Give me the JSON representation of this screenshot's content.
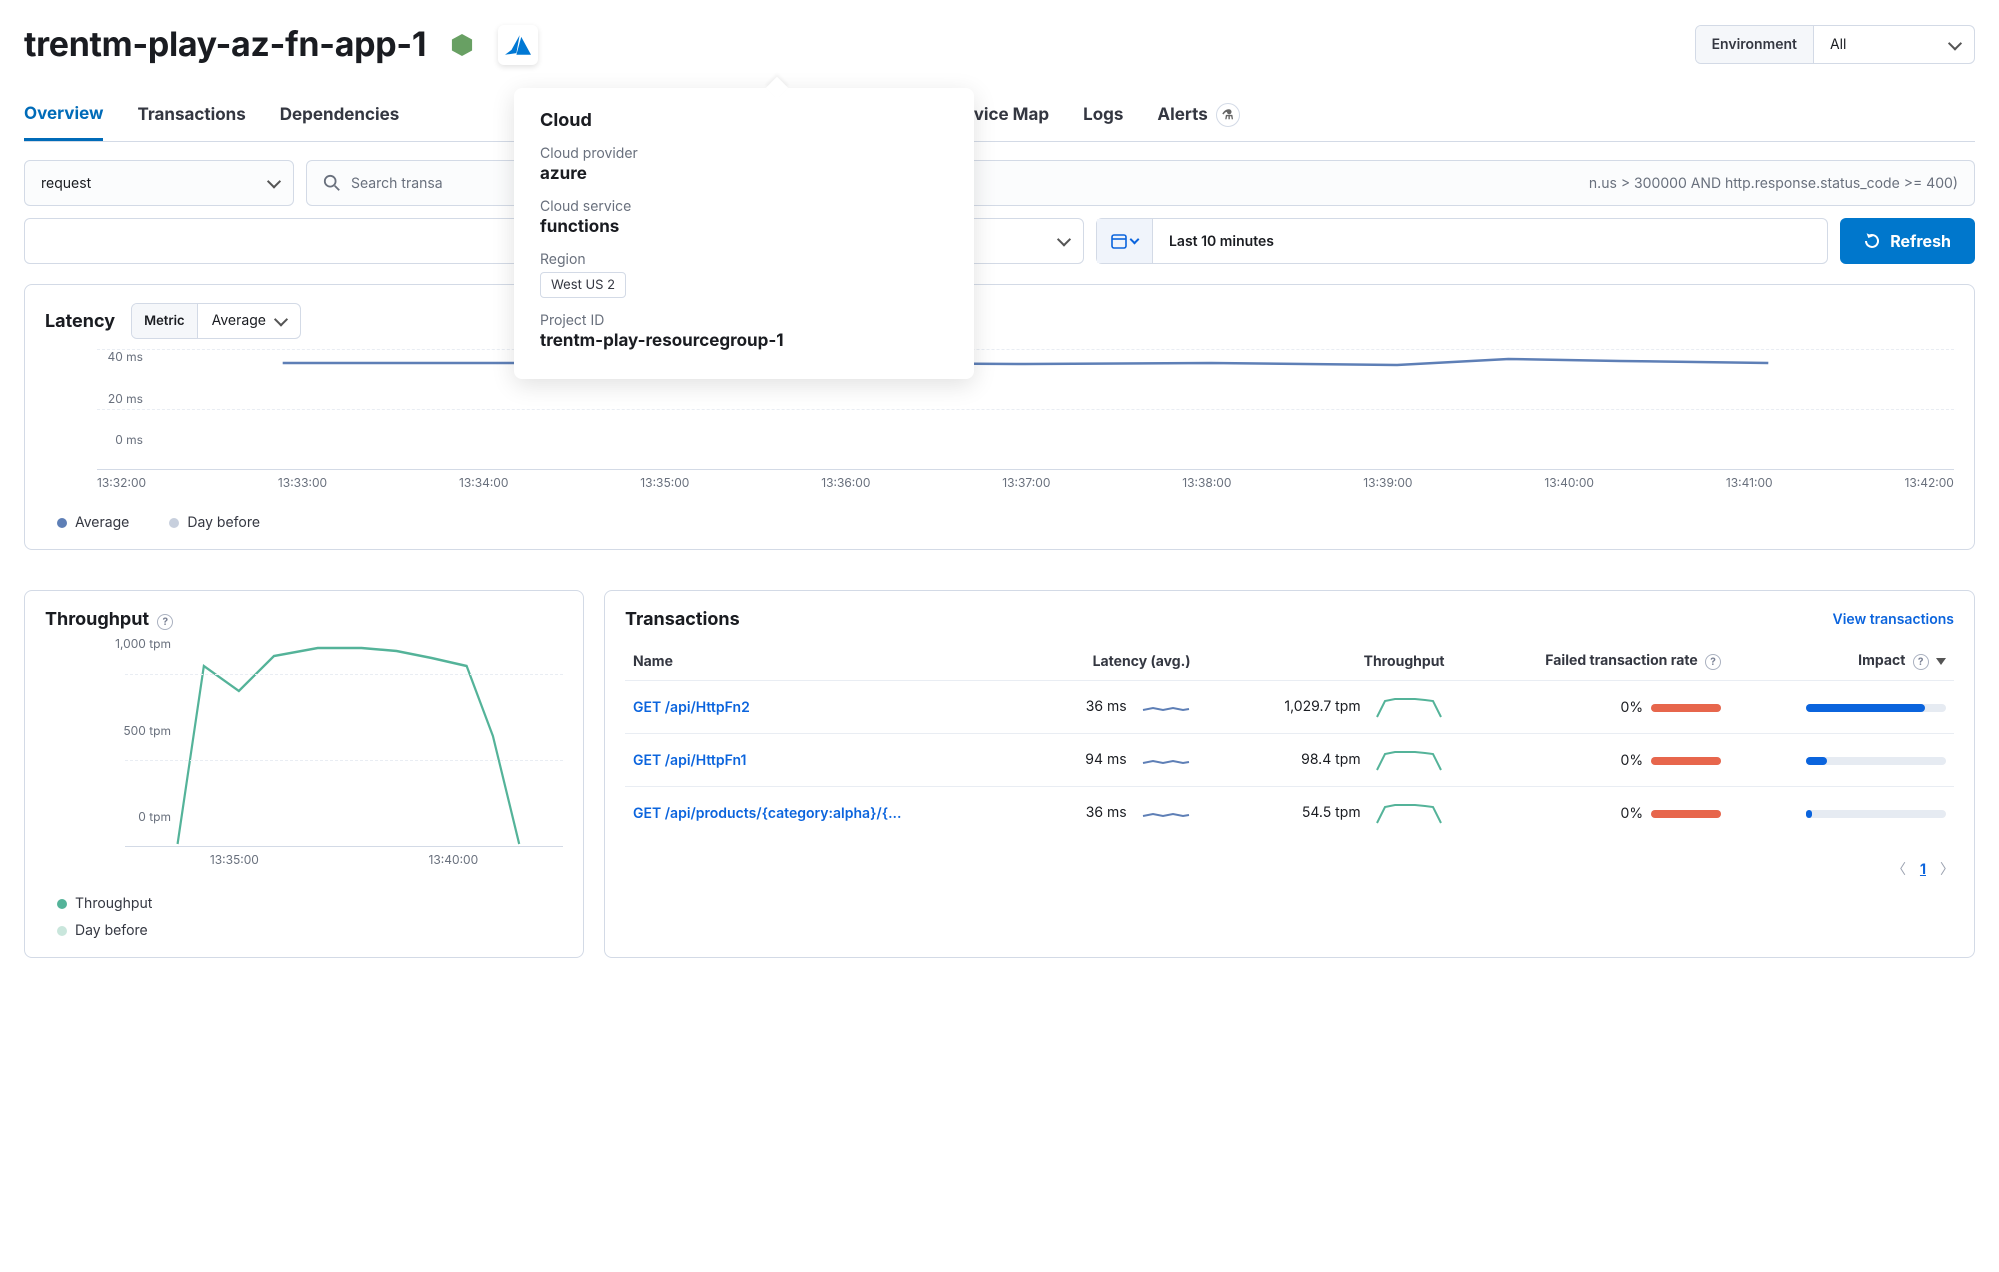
{
  "header": {
    "title": "trentm-play-az-fn-app-1",
    "icons": [
      "nodejs",
      "azure"
    ],
    "env_label": "Environment",
    "env_value": "All"
  },
  "popover": {
    "title": "Cloud",
    "provider_label": "Cloud provider",
    "provider_value": "azure",
    "service_label": "Cloud service",
    "service_value": "functions",
    "region_label": "Region",
    "region_value": "West US 2",
    "project_label": "Project ID",
    "project_value": "trentm-play-resourcegroup-1"
  },
  "tabs": [
    "Overview",
    "Transactions",
    "Dependencies",
    "",
    "",
    "Service Map",
    "Logs",
    "Alerts"
  ],
  "filters": {
    "type_filter": "request",
    "search_placeholder": "Search transa",
    "search_tail": "n.us > 300000 AND http.response.status_code >= 400)",
    "comparison": "",
    "date_range": "Last 10 minutes",
    "refresh": "Refresh"
  },
  "latency": {
    "title": "Latency",
    "metric_label": "Metric",
    "metric_value": "Average",
    "legend_primary": "Average",
    "legend_secondary": "Day before"
  },
  "throughput": {
    "title": "Throughput",
    "legend_primary": "Throughput",
    "legend_secondary": "Day before"
  },
  "transactions_panel": {
    "title": "Transactions",
    "view_link": "View transactions",
    "cols": {
      "name": "Name",
      "latency": "Latency (avg.)",
      "throughput": "Throughput",
      "failed": "Failed transaction rate",
      "impact": "Impact"
    },
    "rows": [
      {
        "name": "GET /api/HttpFn2",
        "latency": "36 ms",
        "throughput": "1,029.7 tpm",
        "failed": "0%",
        "impact": 0.85
      },
      {
        "name": "GET /api/HttpFn1",
        "latency": "94 ms",
        "throughput": "98.4 tpm",
        "failed": "0%",
        "impact": 0.15
      },
      {
        "name": "GET /api/products/{category:alpha}/{...",
        "latency": "36 ms",
        "throughput": "54.5 tpm",
        "failed": "0%",
        "impact": 0.04
      }
    ],
    "page": "1"
  },
  "chart_data": [
    {
      "type": "line",
      "title": "Latency",
      "ylabel": "ms",
      "ylim": [
        0,
        45
      ],
      "yticks": [
        "40 ms",
        "20 ms",
        "0 ms"
      ],
      "x": [
        "13:32:00",
        "13:33:00",
        "13:34:00",
        "13:35:00",
        "13:36:00",
        "13:37:00",
        "13:38:00",
        "13:39:00",
        "13:40:00",
        "13:41:00",
        "13:42:00"
      ],
      "series": [
        {
          "name": "Average",
          "color": "#5e7fb6",
          "values": [
            null,
            40,
            40,
            40,
            40,
            40,
            40,
            39,
            41,
            40,
            null
          ]
        },
        {
          "name": "Day before",
          "color": "#c7cfdd",
          "values": [
            null,
            null,
            null,
            null,
            null,
            null,
            null,
            null,
            null,
            null,
            null
          ]
        }
      ]
    },
    {
      "type": "line",
      "title": "Throughput",
      "ylabel": "tpm",
      "ylim": [
        0,
        1300
      ],
      "yticks": [
        "1,000 tpm",
        "500 tpm",
        "0 tpm"
      ],
      "x": [
        "13:35:00",
        "13:40:00"
      ],
      "series": [
        {
          "name": "Throughput",
          "color": "#54b399",
          "values_full": [
            10,
            1150,
            1080,
            1200,
            1230,
            1230,
            1220,
            1200,
            1150,
            700,
            10
          ]
        },
        {
          "name": "Day before",
          "color": "#c9e6dc",
          "values_full": [
            null,
            null,
            null,
            null,
            null,
            null,
            null,
            null,
            null,
            null,
            null
          ]
        }
      ]
    }
  ]
}
